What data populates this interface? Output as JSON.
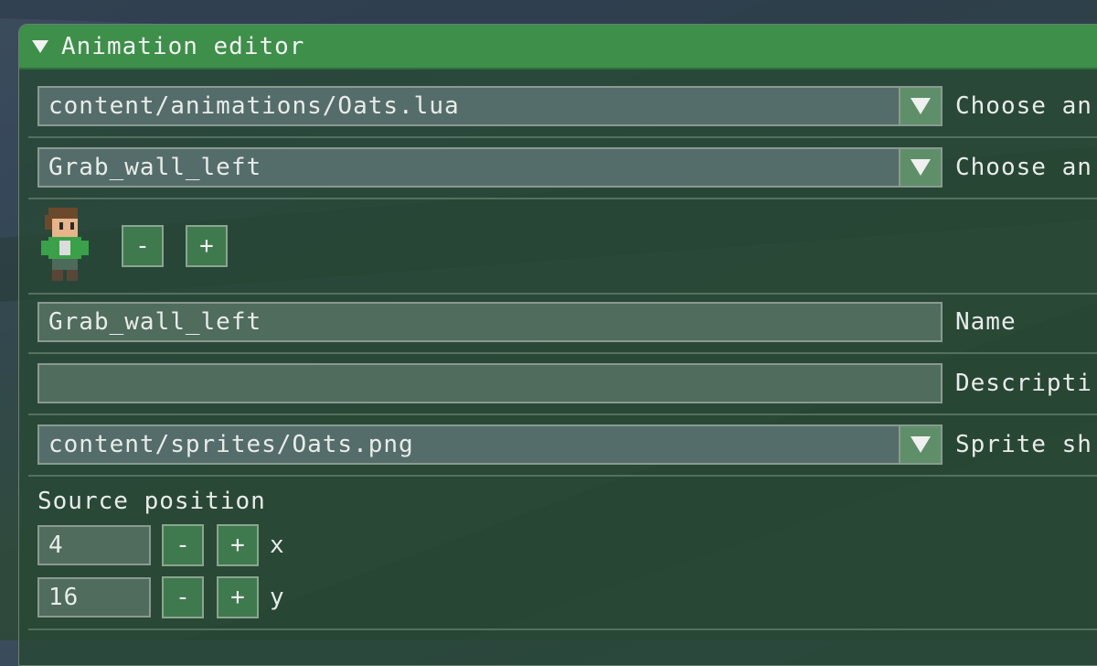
{
  "window": {
    "title": "Animation editor"
  },
  "file_select": {
    "value": "content/animations/Oats.lua",
    "label": "Choose an"
  },
  "anim_select": {
    "value": "Grab_wall_left",
    "label": "Choose an"
  },
  "preview": {
    "minus_label": "-",
    "plus_label": "+"
  },
  "name_field": {
    "value": "Grab_wall_left",
    "label": "Name"
  },
  "description_field": {
    "value": "",
    "label": "Descripti"
  },
  "sprite_select": {
    "value": "content/sprites/Oats.png",
    "label": "Sprite sh"
  },
  "source_position": {
    "heading": "Source position",
    "x": {
      "value": "4",
      "axis": "x",
      "minus": "-",
      "plus": "+"
    },
    "y": {
      "value": "16",
      "axis": "y",
      "minus": "-",
      "plus": "+"
    }
  },
  "colors": {
    "accent": "#3d8f4a",
    "field_bg": "#4f6c5d",
    "button_bg": "#3f7a4e"
  }
}
